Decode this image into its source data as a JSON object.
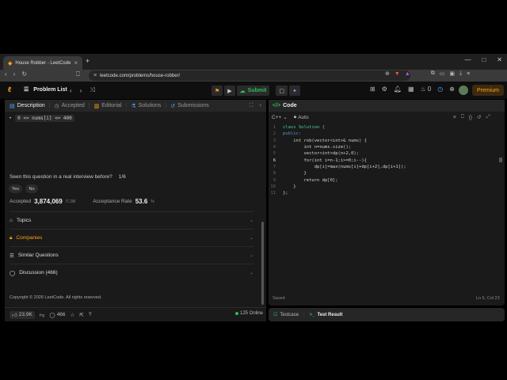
{
  "browser": {
    "tab_title": "House Robber - LeetCode",
    "tab_close": "×",
    "new_tab": "+",
    "url": "leetcode.com/problems/house-robber/",
    "window_controls": [
      "—",
      "□",
      "✕"
    ]
  },
  "nav": {
    "problem_list_label": "Problem List",
    "submit_label": "Submit",
    "notification_count": "0",
    "premium_label": "Premium"
  },
  "left_tabs": {
    "description": "Description",
    "accepted": "Accepted",
    "editorial": "Editorial",
    "solutions": "Solutions",
    "submissions": "Submissions"
  },
  "constraint": {
    "bullet": "•",
    "code": "0 <= nums[i] <= 400"
  },
  "feedback": {
    "question": "Seen this question in a real interview before?",
    "counter": "1/6",
    "yes": "Yes",
    "no": "No"
  },
  "stats": {
    "accepted_label": "Accepted",
    "accepted_value": "3,874,069",
    "accepted_total": "/7.2M",
    "rate_label": "Acceptance Rate",
    "rate_value": "53.6",
    "rate_unit": "%"
  },
  "accordions": {
    "topics": "Topics",
    "companies": "Companies",
    "similar": "Similar Questions",
    "discussion": "Discussion (466)"
  },
  "copyright": "Copyright © 2026 LeetCode. All rights reserved.",
  "footer": {
    "likes": "23.9K",
    "comments": "466",
    "online": "125 Online"
  },
  "code_panel": {
    "title": "Code",
    "language": "C++",
    "auto_label": "Auto",
    "saved": "Saved",
    "cursor": "Ln 6, Col 23",
    "lines": [
      "class Solution {",
      "public:",
      "    int rob(vector<int>& nums) {",
      "        int n=nums.size();",
      "        vector<int>dp(n+2,0);",
      "        for(int i=n-1;i>=0;i--){",
      "            dp[i]=max(nums[i]+dp[i+2],dp[i+1]);",
      "        }",
      "        return dp[0];",
      "    }",
      "};"
    ],
    "line_numbers": [
      "1",
      "2",
      "3",
      "4",
      "5",
      "6",
      "7",
      "8",
      "9",
      "10",
      "11"
    ]
  },
  "bottom_tabs": {
    "testcase": "Testcase",
    "test_result": "Test Result"
  },
  "colors": {
    "accent_orange": "#ffa116",
    "accent_green": "#2cbb5d"
  }
}
